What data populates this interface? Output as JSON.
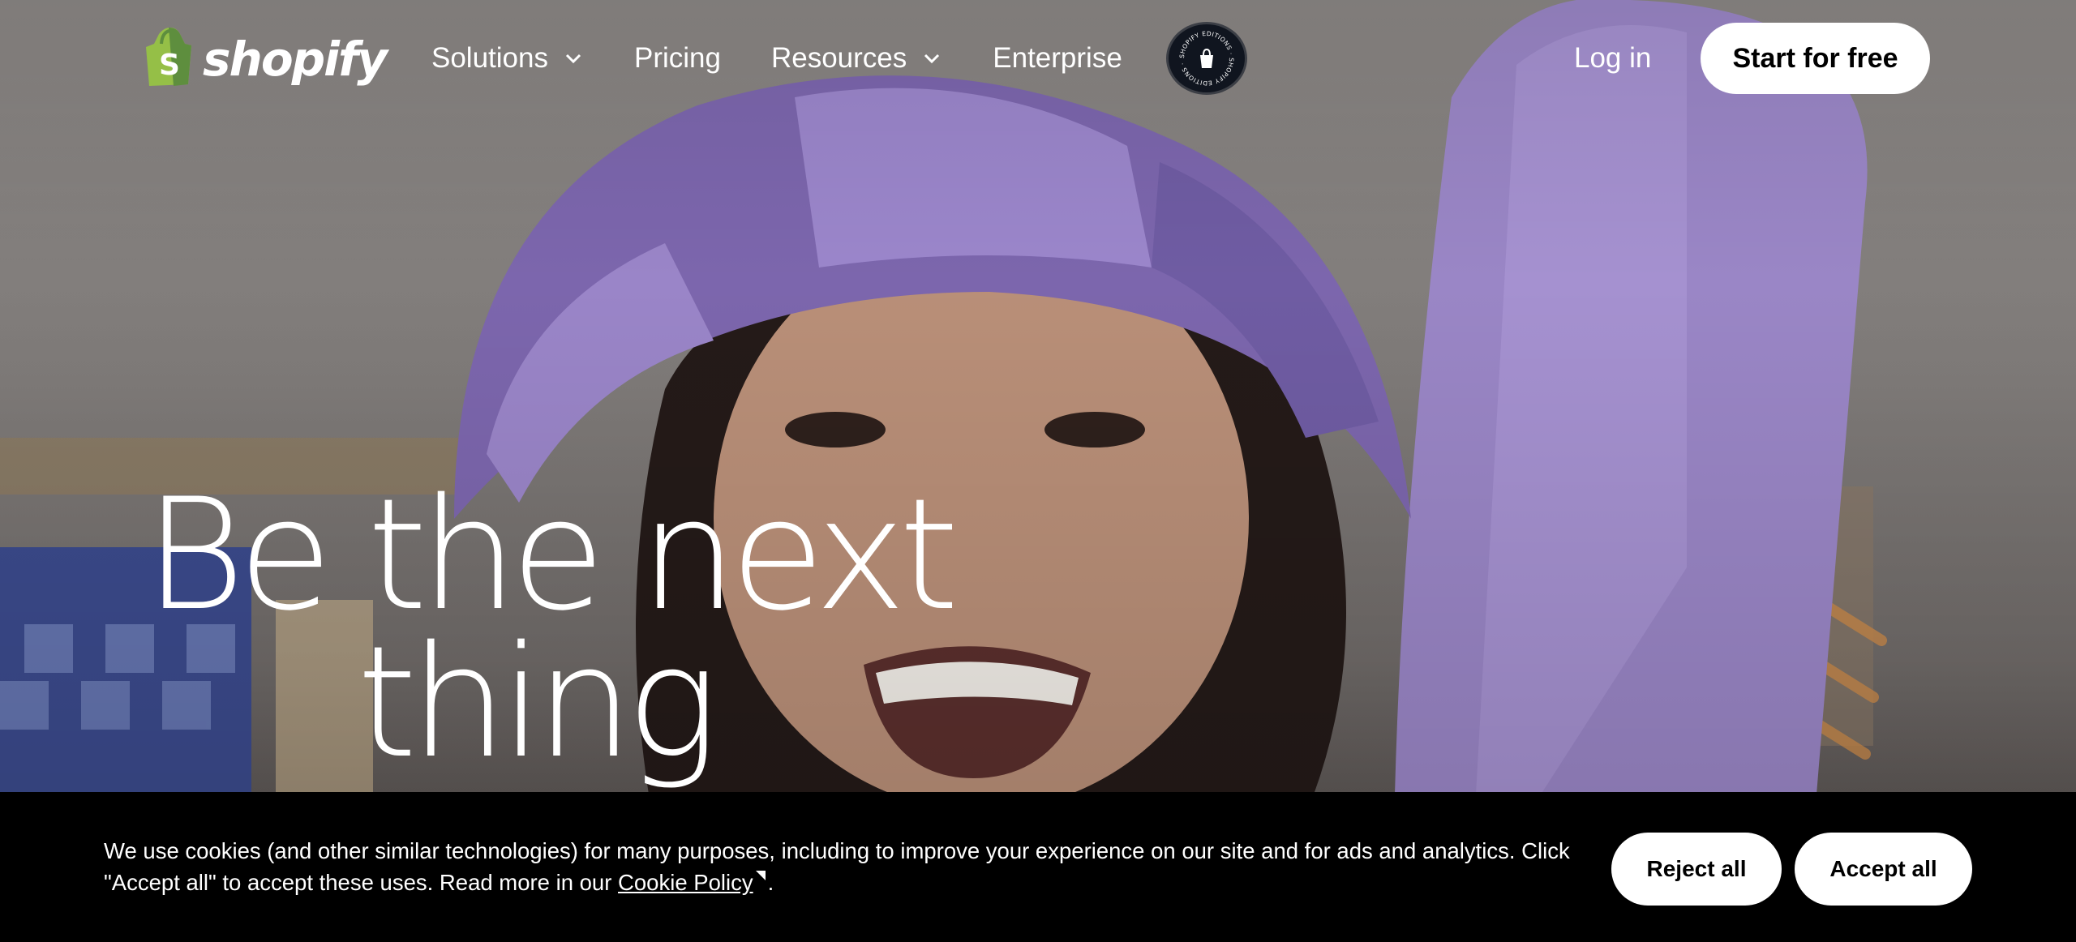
{
  "header": {
    "logo_text": "shopify",
    "logo_icon": "shopping-bag-icon",
    "nav": [
      {
        "label": "Solutions",
        "has_dropdown": true
      },
      {
        "label": "Pricing",
        "has_dropdown": false
      },
      {
        "label": "Resources",
        "has_dropdown": true
      },
      {
        "label": "Enterprise",
        "has_dropdown": false
      }
    ],
    "editions_badge": {
      "ring_text": "SHOPIFY EDITIONS · SHOPIFY EDITIONS ·"
    },
    "login_label": "Log in",
    "cta_label": "Start for free"
  },
  "hero": {
    "headline_line1": "Be the next",
    "headline_line2": "thing"
  },
  "cookie_banner": {
    "text_before_link": "We use cookies (and other similar technologies) for many purposes, including to improve your experience on our site and for ads and analytics. Click \"Accept all\" to accept these uses. Read more in our ",
    "link_label": "Cookie Policy",
    "text_after_link": ".",
    "reject_label": "Reject all",
    "accept_label": "Accept all"
  },
  "colors": {
    "brand_green": "#95bf47",
    "banner_bg": "#000000",
    "button_bg": "#ffffff",
    "hat_purple": "#8a73b5"
  }
}
